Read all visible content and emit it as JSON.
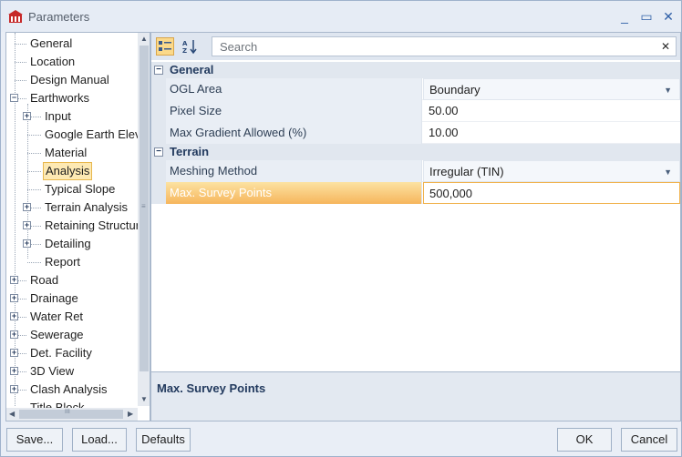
{
  "window": {
    "title": "Parameters",
    "minimize_glyph": "_",
    "maximize_glyph": "▭",
    "close_glyph": "✕"
  },
  "tree": {
    "items": [
      {
        "label": "General",
        "expander": "",
        "selected": false
      },
      {
        "label": "Location",
        "expander": "",
        "selected": false
      },
      {
        "label": "Design Manual",
        "expander": "",
        "selected": false
      },
      {
        "label": "Earthworks",
        "expander": "−",
        "selected": false
      },
      {
        "label": "Input",
        "expander": "+",
        "selected": false
      },
      {
        "label": "Google Earth Eleva",
        "expander": "",
        "selected": false
      },
      {
        "label": "Material",
        "expander": "",
        "selected": false
      },
      {
        "label": "Analysis",
        "expander": "",
        "selected": true
      },
      {
        "label": "Typical Slope",
        "expander": "",
        "selected": false
      },
      {
        "label": "Terrain Analysis",
        "expander": "+",
        "selected": false
      },
      {
        "label": "Retaining Structure",
        "expander": "+",
        "selected": false
      },
      {
        "label": "Detailing",
        "expander": "+",
        "selected": false
      },
      {
        "label": "Report",
        "expander": "",
        "selected": false
      },
      {
        "label": "Road",
        "expander": "+",
        "selected": false
      },
      {
        "label": "Drainage",
        "expander": "+",
        "selected": false
      },
      {
        "label": "Water Ret",
        "expander": "+",
        "selected": false
      },
      {
        "label": "Sewerage",
        "expander": "+",
        "selected": false
      },
      {
        "label": "Det. Facility",
        "expander": "+",
        "selected": false
      },
      {
        "label": "3D View",
        "expander": "+",
        "selected": false
      },
      {
        "label": "Clash Analysis",
        "expander": "+",
        "selected": false
      },
      {
        "label": "Title Block",
        "expander": "",
        "selected": false
      }
    ],
    "scroll_grip": "≡",
    "hscroll_grip": "III"
  },
  "toolbar": {
    "search_placeholder": "Search",
    "clear_glyph": "✕"
  },
  "grid": {
    "categories": [
      {
        "label": "General",
        "toggle": "−",
        "rows": [
          {
            "name": "OGL Area",
            "value": "Boundary",
            "type": "combo"
          },
          {
            "name": "Pixel Size",
            "value": "50.00",
            "type": "text"
          },
          {
            "name": "Max Gradient Allowed (%)",
            "value": "10.00",
            "type": "text"
          }
        ]
      },
      {
        "label": "Terrain",
        "toggle": "−",
        "rows": [
          {
            "name": "Meshing Method",
            "value": "Irregular (TIN)",
            "type": "combo"
          },
          {
            "name": "Max. Survey Points",
            "value": "500,000",
            "type": "text",
            "active": true
          }
        ]
      }
    ],
    "dropdown_glyph": "▼"
  },
  "description": {
    "title": "Max. Survey Points"
  },
  "buttons": {
    "save": "Save...",
    "load": "Load...",
    "defaults": "Defaults",
    "ok": "OK",
    "cancel": "Cancel"
  }
}
